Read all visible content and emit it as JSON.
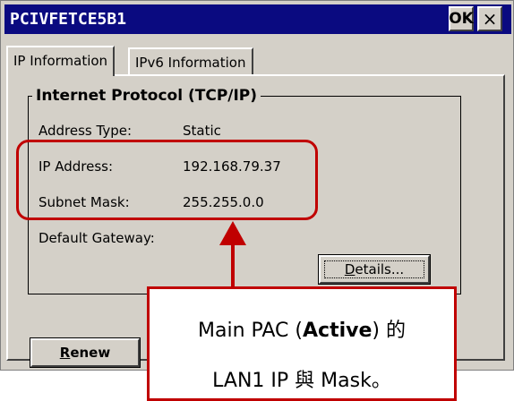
{
  "window": {
    "title": "PCIVFETCE5B1",
    "ok_label": "OK",
    "close_label": "×"
  },
  "tabs": [
    {
      "label": "IP Information",
      "active": true
    },
    {
      "label": "IPv6 Information",
      "active": false
    }
  ],
  "group": {
    "title": "Internet Protocol (TCP/IP)",
    "fields": [
      {
        "label": "Address Type:",
        "value": "Static"
      },
      {
        "label": "IP Address:",
        "value": "192.168.79.37"
      },
      {
        "label": "Subnet Mask:",
        "value": "255.255.0.0"
      },
      {
        "label": "Default Gateway:",
        "value": ""
      }
    ],
    "details_button": {
      "prefix": "",
      "accel": "D",
      "rest": "etails..."
    }
  },
  "renew_button": {
    "accel": "R",
    "rest": "enew"
  },
  "annotation": {
    "line1_prefix": "Main PAC (",
    "line1_bold": "Active",
    "line1_suffix": ") 的",
    "line2": "LAN1 IP 與 Mask。",
    "color": "#c00000"
  }
}
